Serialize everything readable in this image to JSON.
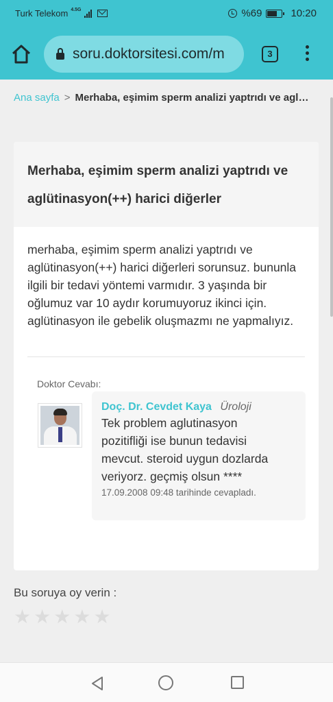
{
  "status_bar": {
    "carrier": "Turk Telekom",
    "network": "4.5G",
    "battery": "%69",
    "battery_level": 0.69,
    "time": "10:20",
    "icons": [
      "signal-icon",
      "mail-icon",
      "alarm-icon",
      "battery-icon"
    ]
  },
  "browser": {
    "url": "soru.doktorsitesi.com/m",
    "tab_count": "3",
    "icons": [
      "home-icon",
      "lock-icon",
      "tabs-icon",
      "overflow-menu-icon"
    ]
  },
  "breadcrumb": {
    "home": "Ana sayfa",
    "separator": ">",
    "current": "Merhaba, eşimim sperm analizi yaptrıdı ve aglütinasyon(++) harici diğerler"
  },
  "question": {
    "title": "Merhaba, eşimim sperm analizi yaptrıdı ve aglütinasyon(++) harici diğerler",
    "body": "merhaba, eşimim sperm analizi yaptrıdı ve aglütinasyon(++) harici diğerleri sorunsuz. bununla ilgili bir tedavi yöntemi varmıdır. 3 yaşında bir oğlumuz var 10 aydır korumuyoruz ikinci için. aglütinasyon ile gebelik oluşmazmı ne yapmalıyız."
  },
  "answer": {
    "label": "Doktor Cevabı:",
    "doctor_name": "Doç. Dr. Cevdet Kaya",
    "department": "Üroloji",
    "text": "Tek problem aglutinasyon pozitifliği ise bunun tedavisi mevcut. steroid uygun dozlarda veriyorz. geçmiş olsun ****",
    "date": "17.09.2008 09:48 tarihinde cevapladı."
  },
  "rating": {
    "label": "Bu soruya oy verin :",
    "stars": [
      {
        "icon": "star-icon"
      },
      {
        "icon": "star-icon"
      },
      {
        "icon": "star-icon"
      },
      {
        "icon": "star-icon"
      },
      {
        "icon": "star-icon"
      }
    ],
    "selected": 0,
    "max": 5
  },
  "nav_bar": {
    "icons": [
      "back-icon",
      "home-circle-icon",
      "recent-apps-icon"
    ]
  },
  "colors": {
    "accent": "#3fc4d0",
    "background": "#efefef"
  }
}
